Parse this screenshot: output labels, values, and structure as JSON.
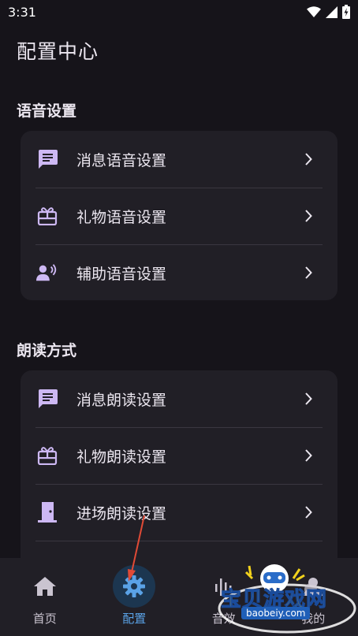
{
  "status_bar": {
    "time": "3:31",
    "icons": [
      "wifi-icon",
      "cellular-signal-icon",
      "battery-charging-icon"
    ]
  },
  "page_title": "配置中心",
  "sections": [
    {
      "title": "语音设置",
      "items": [
        {
          "label": "消息语音设置",
          "icon": "message-icon"
        },
        {
          "label": "礼物语音设置",
          "icon": "gift-icon"
        },
        {
          "label": "辅助语音设置",
          "icon": "voice-person-icon"
        }
      ]
    },
    {
      "title": "朗读方式",
      "items": [
        {
          "label": "消息朗读设置",
          "icon": "message-icon"
        },
        {
          "label": "礼物朗读设置",
          "icon": "gift-icon"
        },
        {
          "label": "进场朗读设置",
          "icon": "door-icon"
        }
      ]
    }
  ],
  "bottom_nav": {
    "items": [
      {
        "label": "首页",
        "icon": "home-icon",
        "active": false
      },
      {
        "label": "配置",
        "icon": "gear-icon",
        "active": true
      },
      {
        "label": "音效",
        "icon": "equalizer-icon",
        "active": false
      },
      {
        "label": "我的",
        "icon": "person-icon",
        "active": false
      }
    ]
  },
  "watermark": {
    "text": "宝贝游戏网",
    "url": "baobeiy.com"
  },
  "colors": {
    "background": "#16141a",
    "card": "#211f26",
    "icon_accent": "#cdb8f3",
    "active_nav": "#5aa2e6",
    "annotation_arrow": "#e04a36"
  }
}
